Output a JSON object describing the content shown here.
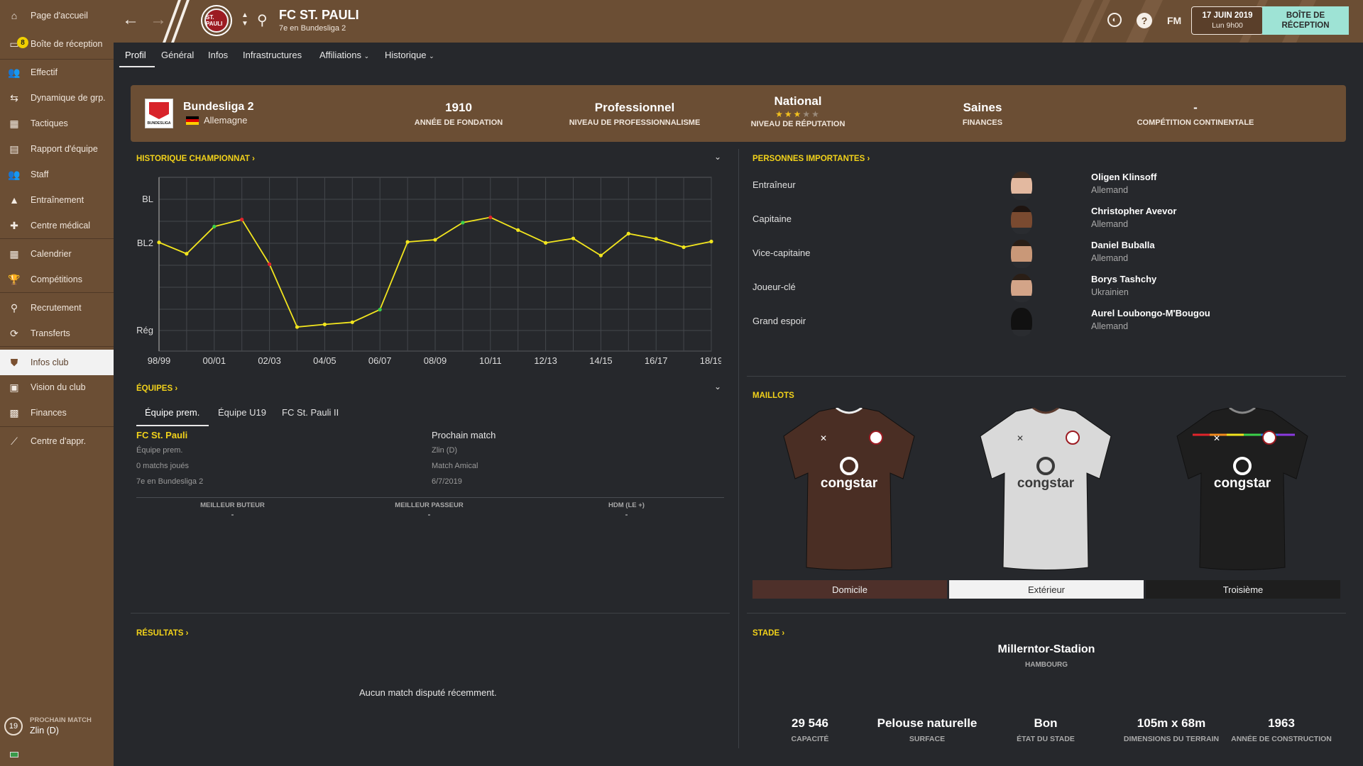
{
  "sidebar": {
    "items": [
      {
        "label": "Page d'accueil",
        "icon": "home-icon"
      },
      {
        "label": "Boîte de réception",
        "icon": "inbox-icon",
        "badge": "8"
      },
      {
        "label": "Effectif",
        "icon": "squad-icon"
      },
      {
        "label": "Dynamique de grp.",
        "icon": "dynamics-icon"
      },
      {
        "label": "Tactiques",
        "icon": "tactics-icon"
      },
      {
        "label": "Rapport d'équipe",
        "icon": "report-icon"
      },
      {
        "label": "Staff",
        "icon": "staff-icon"
      },
      {
        "label": "Entraînement",
        "icon": "training-icon"
      },
      {
        "label": "Centre médical",
        "icon": "medical-icon"
      },
      {
        "label": "Calendrier",
        "icon": "calendar-icon"
      },
      {
        "label": "Compétitions",
        "icon": "trophy-icon"
      },
      {
        "label": "Recrutement",
        "icon": "search-icon"
      },
      {
        "label": "Transferts",
        "icon": "transfer-icon"
      },
      {
        "label": "Infos club",
        "icon": "club-shield-icon"
      },
      {
        "label": "Vision du club",
        "icon": "vision-icon"
      },
      {
        "label": "Finances",
        "icon": "finances-icon"
      },
      {
        "label": "Centre d'appr.",
        "icon": "development-icon"
      }
    ],
    "next_match_label": "PROCHAIN MATCH",
    "next_match_value": "Zlin (D)",
    "next_match_days": "19"
  },
  "topbar": {
    "club_name": "FC ST. PAULI",
    "club_subtitle": "7e en Bundesliga 2",
    "fm_label": "FM",
    "date": "17 JUIN 2019",
    "time": "Lun 9h00",
    "inbox_button": "BOÎTE DE RÉCEPTION",
    "crest_text": "ST. PAULI"
  },
  "tabs": [
    "Profil",
    "Général",
    "Infos",
    "Infrastructures",
    "Affiliations",
    "Historique"
  ],
  "info_bar": {
    "league": "Bundesliga 2",
    "country": "Allemagne",
    "league_logo_text": "BUNDESLIGA",
    "stats": [
      {
        "value": "1910",
        "label": "ANNÉE DE FONDATION"
      },
      {
        "value": "Professionnel",
        "label": "NIVEAU DE PROFESSIONNALISME"
      },
      {
        "value": "National",
        "label": "NIVEAU DE RÉPUTATION",
        "stars": 3,
        "max_stars": 5
      },
      {
        "value": "Saines",
        "label": "FINANCES"
      },
      {
        "value": "-",
        "label": "COMPÉTITION CONTINENTALE"
      }
    ]
  },
  "history": {
    "title": "HISTORIQUE CHAMPIONNAT"
  },
  "chart_data": {
    "type": "line",
    "x": [
      "98/99",
      "99/00",
      "00/01",
      "01/02",
      "02/03",
      "03/04",
      "04/05",
      "05/06",
      "06/07",
      "07/08",
      "08/09",
      "09/10",
      "10/11",
      "11/12",
      "12/13",
      "13/14",
      "14/15",
      "15/16",
      "16/17",
      "17/18",
      "18/19"
    ],
    "x_tick_labels": [
      "98/99",
      "00/01",
      "02/03",
      "04/05",
      "06/07",
      "08/09",
      "10/11",
      "12/13",
      "14/15",
      "16/17",
      "18/19"
    ],
    "y_levels": [
      "BL",
      "BL2",
      "Rég"
    ],
    "values": [
      0.98,
      1.24,
      0.62,
      0.46,
      1.48,
      2.92,
      2.86,
      2.81,
      2.52,
      0.97,
      0.92,
      0.53,
      0.41,
      0.7,
      0.99,
      0.89,
      1.28,
      0.78,
      0.9,
      1.09,
      0.96
    ],
    "point_colors": [
      "#f2e51e",
      "#f2e51e",
      "#3bd14a",
      "#e0242b",
      "#e0242b",
      "#f2e51e",
      "#f2e51e",
      "#f2e51e",
      "#3bd14a",
      "#f2e51e",
      "#f2e51e",
      "#3bd14a",
      "#e0242b",
      "#f2e51e",
      "#f2e51e",
      "#f2e51e",
      "#f2e51e",
      "#f2e51e",
      "#f2e51e",
      "#f2e51e",
      "#f2e51e"
    ],
    "line_color": "#f2e51e",
    "grid": true
  },
  "teams": {
    "title": "ÉQUIPES",
    "tabs": [
      "Équipe prem.",
      "Équipe U19",
      "FC St. Pauli II"
    ],
    "team_name": "FC St. Pauli",
    "team_lines": [
      "Équipe prem.",
      "0 matchs joués",
      "7e en Bundesliga 2"
    ],
    "next_match_title": "Prochain match",
    "next_match_lines": [
      "Zlin (D)",
      "Match Amical",
      "6/7/2019"
    ],
    "stats": [
      {
        "label": "MEILLEUR BUTEUR",
        "value": "-"
      },
      {
        "label": "MEILLEUR PASSEUR",
        "value": "-"
      },
      {
        "label": "HDM (LE +)",
        "value": "-"
      }
    ]
  },
  "results": {
    "title": "RÉSULTATS",
    "empty": "Aucun match disputé récemment."
  },
  "people": {
    "title": "PERSONNES IMPORTANTES",
    "list": [
      {
        "role": "Entraîneur",
        "name": "Oligen Klinsoff",
        "nationality": "Allemand",
        "skin": "#e3b9a0",
        "hair": "#3a2a20"
      },
      {
        "role": "Capitaine",
        "name": "Christopher Avevor",
        "nationality": "Allemand",
        "skin": "#7a4a30",
        "hair": "#1e1410"
      },
      {
        "role": "Vice-capitaine",
        "name": "Daniel Buballa",
        "nationality": "Allemand",
        "skin": "#c99878",
        "hair": "#2a1e16"
      },
      {
        "role": "Joueur-clé",
        "name": "Borys Tashchy",
        "nationality": "Ukrainien",
        "skin": "#d3a488",
        "hair": "#2a1e16"
      },
      {
        "role": "Grand espoir",
        "name": "Aurel Loubongo-M'Bougou",
        "nationality": "Allemand",
        "skin": "#111111",
        "hair": "#111111"
      }
    ]
  },
  "kits": {
    "title": "MAILLOTS",
    "sponsor": "congstar",
    "items": [
      {
        "label": "Domicile",
        "shirt": "#4a2e24",
        "text": "#ffffff",
        "tab_bg": "#4e302a",
        "tab_fg": "#f2f2f2"
      },
      {
        "label": "Extérieur",
        "shirt": "#d9d9d9",
        "text": "#3a3a3a",
        "tab_bg": "#f2f2f2",
        "tab_fg": "#2e2e2e"
      },
      {
        "label": "Troisième",
        "shirt": "#1e1e1e",
        "text": "#ffffff",
        "tab_bg": "#1e1e1e",
        "tab_fg": "#f2f2f2"
      }
    ]
  },
  "stadium": {
    "title": "STADE",
    "name": "Millerntor-Stadion",
    "city": "HAMBOURG",
    "stats": [
      {
        "value": "29 546",
        "label": "CAPACITÉ"
      },
      {
        "value": "Pelouse naturelle",
        "label": "SURFACE"
      },
      {
        "value": "Bon",
        "label": "ÉTAT DU STADE"
      },
      {
        "value": "105m x 68m",
        "label": "DIMENSIONS DU TERRAIN"
      },
      {
        "value": "1963",
        "label": "ANNÉE DE CONSTRUCTION"
      }
    ]
  },
  "colors": {
    "brown": "#6b4e34",
    "accent_yellow": "#f2d21a",
    "background": "#26282c"
  }
}
